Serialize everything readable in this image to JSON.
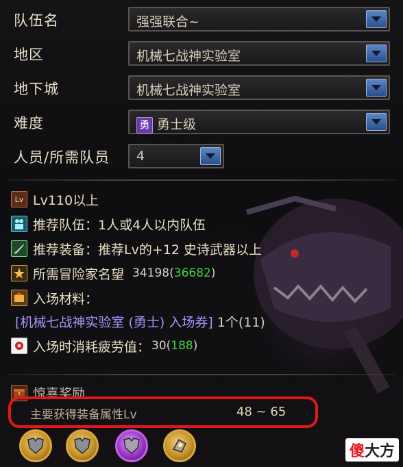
{
  "form": {
    "team_name_label": "队伍名",
    "team_name_value": "强强联合~",
    "region_label": "地区",
    "region_value": "机械七战神实验室",
    "dungeon_label": "地下城",
    "dungeon_value": "机械七战神实验室",
    "difficulty_label": "难度",
    "difficulty_badge": "勇",
    "difficulty_value": "勇士级",
    "members_label": "人员/所需队员",
    "members_value": "4"
  },
  "info": {
    "level_icon_text": "Lv",
    "level_req": "Lv110以上",
    "team_rec": "推荐队伍：1人或4人以内队伍",
    "gear_rec": "推荐装备：推荐Lv的+12 史诗武器以上",
    "fame_label": "所需冒险家名望",
    "fame_required": "34198",
    "fame_open": "(",
    "fame_current": "36682",
    "fame_close": ")",
    "material_label": "入场材料：",
    "ticket_name": "[机械七战神实验室 (勇士) 入场券]",
    "ticket_count": "1个(11)",
    "fatigue_label": "入场时消耗疲劳值：",
    "fatigue_cost": "30",
    "fatigue_open": "(",
    "fatigue_current": "188",
    "fatigue_close": ")"
  },
  "reward": {
    "title": "惊喜奖励",
    "main_label": "主要获得装备属性Lv",
    "range": "48 ~ 65"
  },
  "watermark": {
    "part1": "傻",
    "part2": "大方"
  },
  "colors": {
    "accent_blue": "#4a74b8",
    "fame_green": "#3fd13f",
    "ticket_purple": "#a594ff",
    "highlight_red": "#e01818"
  },
  "icons": {
    "level": "level-icon",
    "team": "team-icon",
    "gear": "sword-icon",
    "fame": "fame-icon",
    "material": "material-icon",
    "fatigue": "fatigue-icon",
    "reward": "reward-chest-icon"
  }
}
